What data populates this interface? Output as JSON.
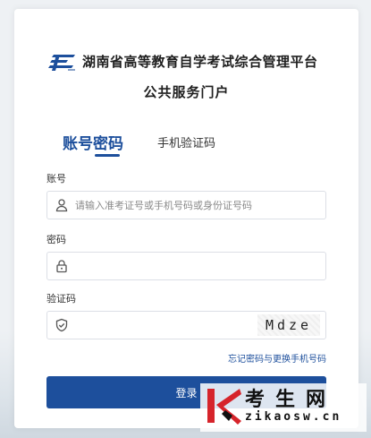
{
  "brand": {
    "title": "湖南省高等教育自学考试综合管理平台",
    "subtitle": "公共服务门户"
  },
  "tabs": [
    {
      "label": "账号密码",
      "active": true
    },
    {
      "label": "手机验证码",
      "active": false
    }
  ],
  "form": {
    "account": {
      "label": "账号",
      "value": "",
      "placeholder": "请输入准考证号或手机号码或身份证号码"
    },
    "password": {
      "label": "密码",
      "value": "",
      "placeholder": ""
    },
    "captcha": {
      "label": "验证码",
      "value": "",
      "placeholder": "",
      "code": "Mdze"
    },
    "forgot_link": "忘记密码与更换手机号码",
    "submit_label": "登录"
  },
  "watermark": {
    "name": "考生网",
    "url": "zikaosw.cn"
  },
  "colors": {
    "accent": "#1d4f9c",
    "watermark_red": "#d6242b"
  },
  "icons": {
    "logo": "exam-logo-icon",
    "account": "user-icon",
    "password": "lock-icon",
    "captcha": "shield-check-icon"
  }
}
